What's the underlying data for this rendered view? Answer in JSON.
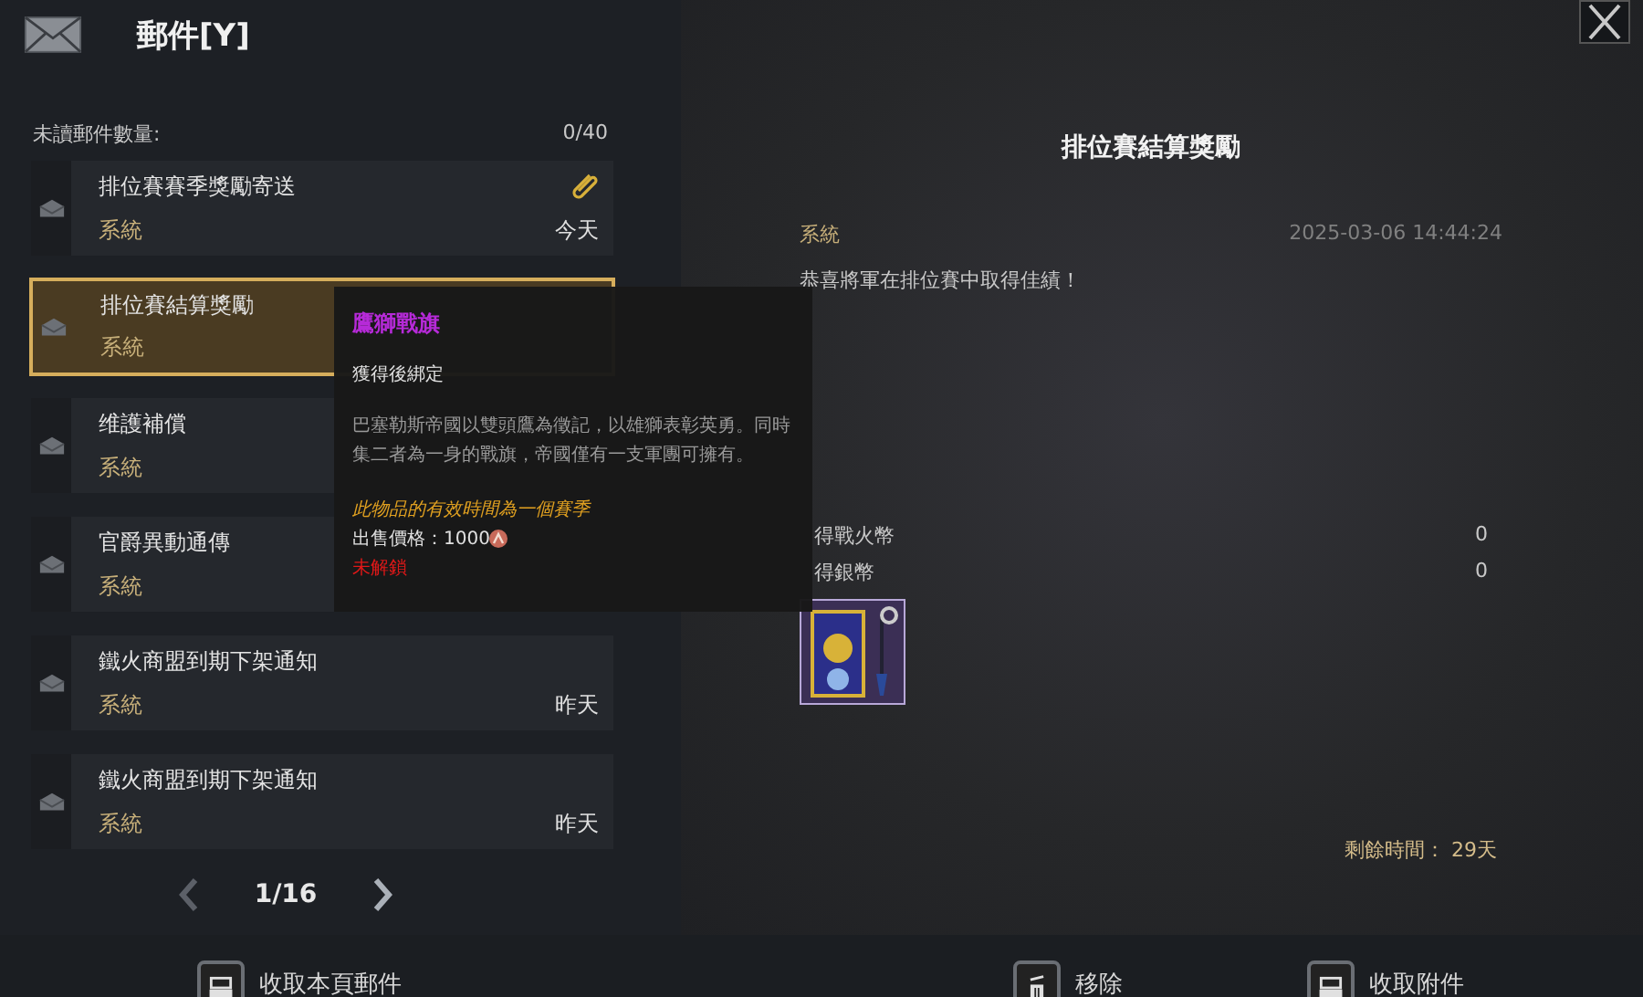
{
  "header": {
    "title": "郵件[Y]"
  },
  "unread": {
    "label": "未讀郵件數量:",
    "count": "0/40"
  },
  "mails": [
    {
      "title": "排位賽賽季獎勵寄送",
      "sender": "系統",
      "date": "今天",
      "attachment": true,
      "selected": false
    },
    {
      "title": "排位賽結算獎勵",
      "sender": "系統",
      "attachment": false,
      "selected": true
    },
    {
      "title": "维護補償",
      "sender": "系統",
      "attachment": false,
      "selected": false
    },
    {
      "title": "官爵異動通傳",
      "sender": "系統",
      "attachment": false,
      "selected": false
    },
    {
      "title": "鐵火商盟到期下架通知",
      "sender": "系統",
      "date": "昨天",
      "attachment": false,
      "selected": false
    },
    {
      "title": "鐵火商盟到期下架通知",
      "sender": "系統",
      "date": "昨天",
      "attachment": false,
      "selected": false
    }
  ],
  "pagination": {
    "page": "1/16"
  },
  "tooltip": {
    "name": "鷹獅戰旗",
    "bind": "獲得後綁定",
    "description": "巴塞勒斯帝國以雙頭鷹為徵記，以雄獅表彰英勇。同時集二者為一身的戰旗，帝國僅有一支軍團可擁有。",
    "validity": "此物品的有效時間為一個賽季",
    "price": "出售價格：1000",
    "lock": "未解鎖"
  },
  "detail": {
    "title": "排位賽結算獎勵",
    "sender": "系統",
    "timestamp": "2025-03-06 14:44:24",
    "message": "恭喜將軍在排位賽中取得佳績！",
    "rewards": [
      {
        "label": "得戰火幣",
        "value": "0"
      },
      {
        "label": "得銀幣",
        "value": "0"
      }
    ],
    "remaining": "剩餘時間： 29天"
  },
  "actions": [
    {
      "kind": "collect",
      "label": "收取本頁郵件"
    },
    {
      "kind": "delete",
      "label": "移除"
    },
    {
      "kind": "collect",
      "label": "收取附件"
    }
  ]
}
